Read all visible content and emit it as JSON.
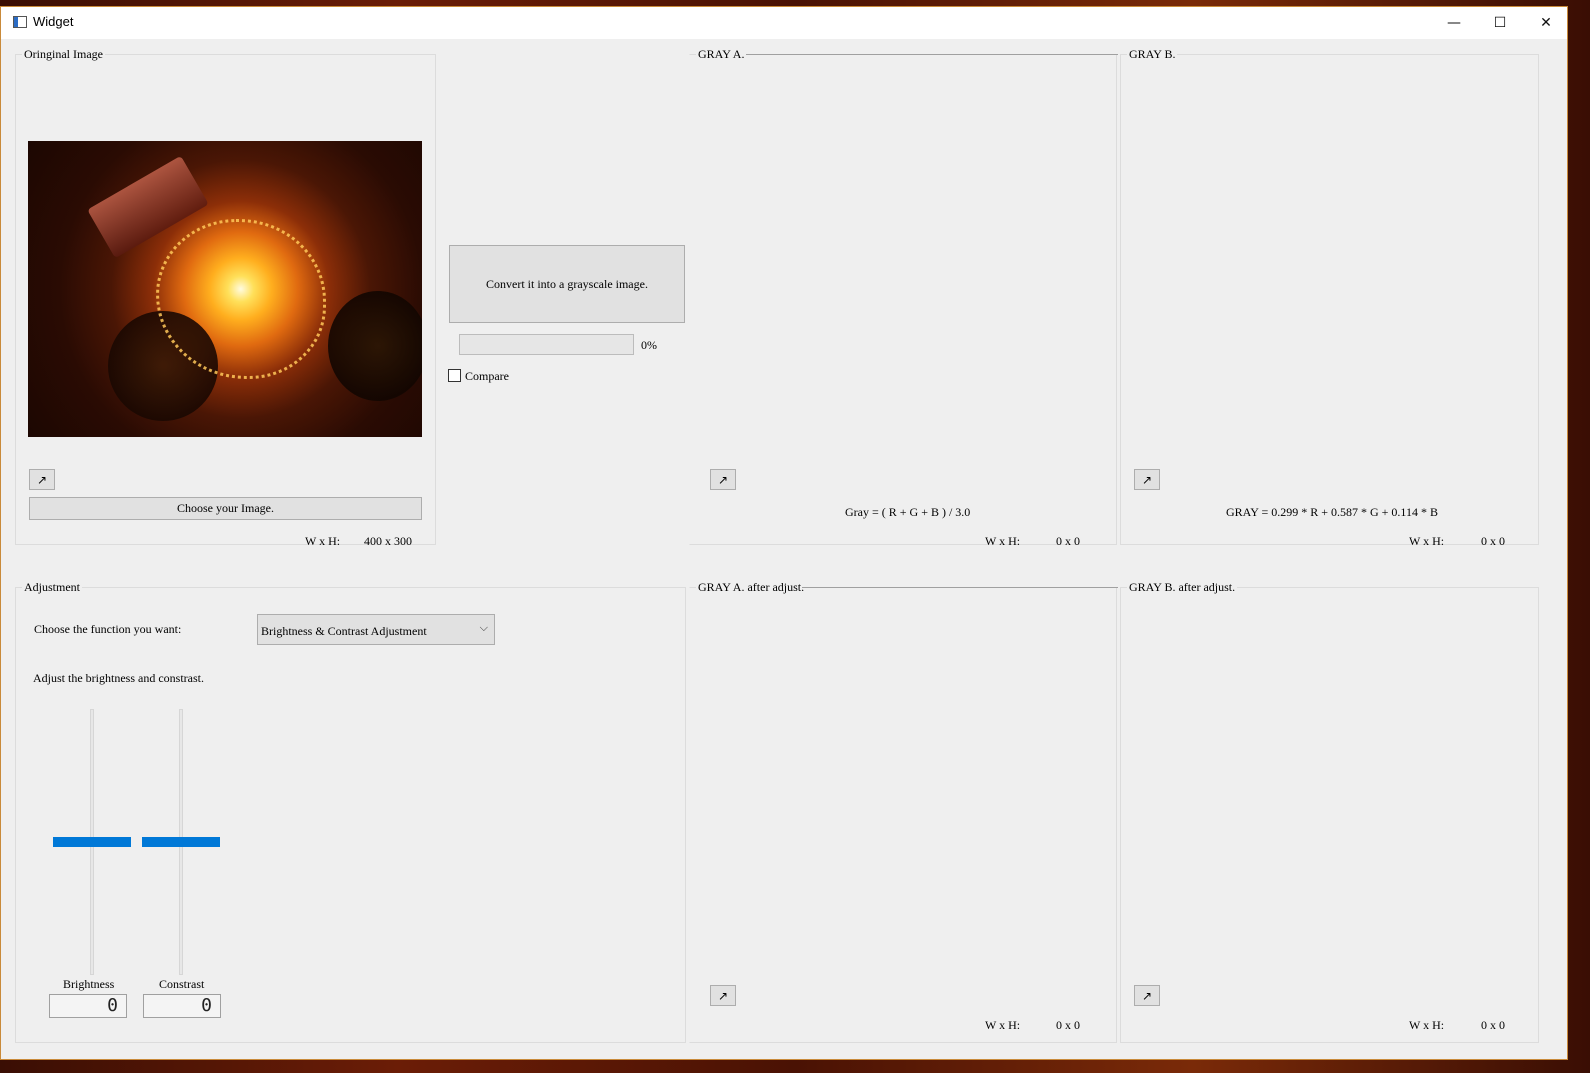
{
  "window": {
    "title": "Widget",
    "minimize": "—",
    "maximize": "☐",
    "close": "✕"
  },
  "original": {
    "group_title": "Oringinal Image",
    "choose_button": "Choose your Image.",
    "wh_label": "W x H:",
    "wh_value": "400 x 300"
  },
  "convert": {
    "button": "Convert it into a grayscale image.",
    "progress_text": "0%",
    "progress_value": 0,
    "compare_label": "Compare",
    "compare_checked": false
  },
  "gray_a": {
    "group_title": "GRAY A.",
    "formula": "Gray = ( R + G + B ) / 3.0",
    "wh_label": "W x H:",
    "wh_value": "0 x 0"
  },
  "gray_b": {
    "group_title": "GRAY B.",
    "formula": "GRAY = 0.299 * R + 0.587 * G + 0.114 * B",
    "wh_label": "W x H:",
    "wh_value": "0 x 0"
  },
  "adjustment": {
    "group_title": "Adjustment",
    "choose_label": "Choose the function you want:",
    "function_selected": "Brightness & Contrast Adjustment",
    "hint": "Adjust the brightness and constrast.",
    "brightness_label": "Brightness",
    "brightness_value": "0",
    "contrast_label": "Constrast",
    "contrast_value": "0"
  },
  "gray_a_adj": {
    "group_title": "GRAY A. after adjust.",
    "wh_label": "W x H:",
    "wh_value": "0 x 0"
  },
  "gray_b_adj": {
    "group_title": "GRAY B. after adjust.",
    "wh_label": "W x H:",
    "wh_value": "0 x 0"
  },
  "icons": {
    "expand": "↗"
  },
  "colors": {
    "accent": "#0078d7",
    "panel": "#efefef",
    "button": "#e1e1e1"
  }
}
